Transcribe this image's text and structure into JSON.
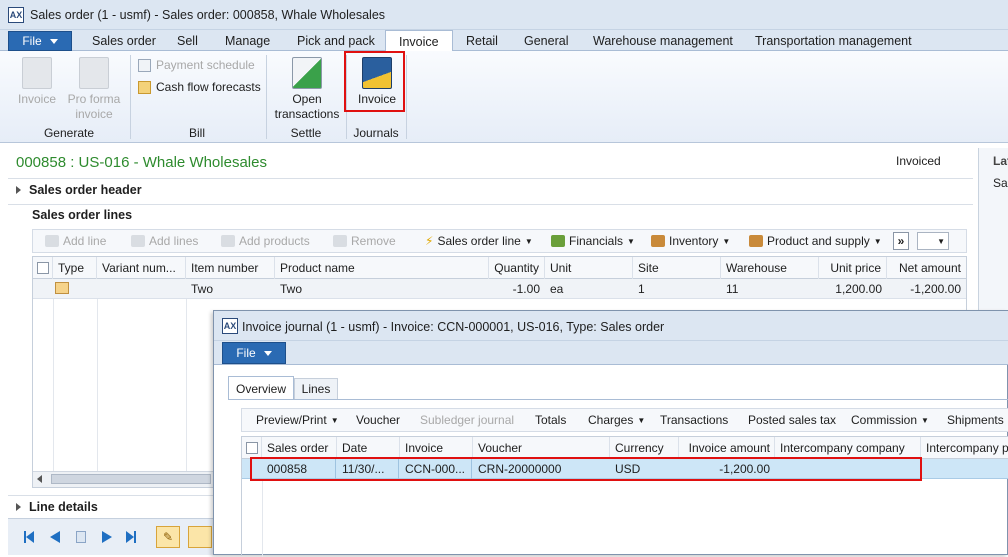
{
  "window": {
    "title": "Sales order (1 - usmf) - Sales order: 000858, Whale Wholesales",
    "app_icon": "ax-icon"
  },
  "tabs": {
    "file_label": "File",
    "items": [
      {
        "label": "Sales order"
      },
      {
        "label": "Sell"
      },
      {
        "label": "Manage"
      },
      {
        "label": "Pick and pack"
      },
      {
        "label": "Invoice",
        "active": true
      },
      {
        "label": "Retail"
      },
      {
        "label": "General"
      },
      {
        "label": "Warehouse management"
      },
      {
        "label": "Transportation management"
      }
    ]
  },
  "ribbon": {
    "generate": {
      "label": "Generate",
      "invoice": "Invoice",
      "pro_forma_1": "Pro forma",
      "pro_forma_2": "invoice"
    },
    "bill": {
      "label": "Bill",
      "payment_schedule": "Payment schedule",
      "cash_flow": "Cash flow forecasts"
    },
    "settle": {
      "label": "Settle",
      "open_1": "Open",
      "open_2": "transactions"
    },
    "journals": {
      "label": "Journals",
      "invoice": "Invoice"
    }
  },
  "order": {
    "title": "000858 : US-016 - Whale Wholesales",
    "status": "Invoiced",
    "side_label": "Lat",
    "side_value": "Sa"
  },
  "sections": {
    "header": "Sales order header",
    "lines": "Sales order lines",
    "details": "Line details"
  },
  "lines_toolbar": {
    "add_line": "Add line",
    "add_lines": "Add lines",
    "add_products": "Add products",
    "remove": "Remove",
    "sales_order_line": "Sales order line",
    "financials": "Financials",
    "inventory": "Inventory",
    "product_supply": "Product and supply",
    "more": "»"
  },
  "lines_grid": {
    "columns": [
      "Type",
      "Variant num...",
      "Item number",
      "Product name",
      "Quantity",
      "Unit",
      "Site",
      "Warehouse",
      "Unit price",
      "Net amount"
    ],
    "rows": [
      {
        "item": "Two",
        "product": "Two",
        "quantity": "-1.00",
        "unit": "ea",
        "site": "1",
        "warehouse": "11",
        "unit_price": "1,200.00",
        "net_amount": "-1,200.00"
      }
    ]
  },
  "journal": {
    "title": "Invoice journal (1 - usmf) - Invoice: CCN-000001, US-016, Type: Sales order",
    "file_label": "File",
    "tabs": [
      "Overview",
      "Lines"
    ],
    "toolbar": [
      "Preview/Print",
      "Voucher",
      "Subledger journal",
      "Totals",
      "Charges",
      "Transactions",
      "Posted sales tax",
      "Commission",
      "Shipments"
    ],
    "columns": [
      "Sales order",
      "Date",
      "Invoice",
      "Voucher",
      "Currency",
      "Invoice amount",
      "Intercompany company",
      "Intercompany p"
    ],
    "row": {
      "sales_order": "000858",
      "date": "11/30/...",
      "invoice": "CCN-000...",
      "voucher": "CRN-20000000",
      "currency": "USD",
      "amount": "-1,200.00"
    }
  },
  "colors": {
    "accent": "#2a6ab3",
    "title_green": "#2e8b2e",
    "highlight": "#e01010",
    "selected_row": "#cde6f7"
  }
}
